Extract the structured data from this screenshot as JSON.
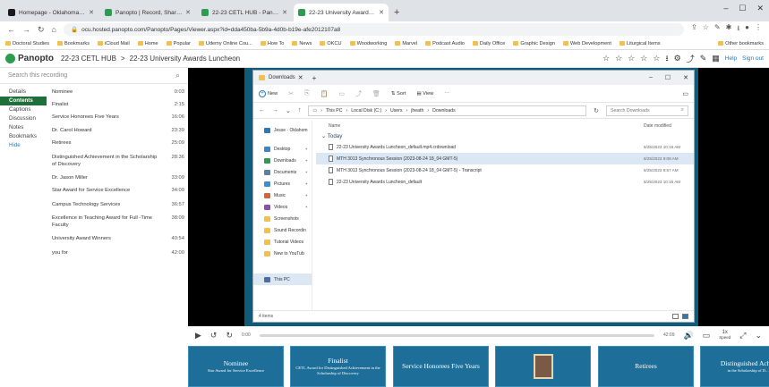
{
  "browser": {
    "tabs": [
      {
        "title": "Homepage - Oklahoma City Uni...",
        "fav": "#1a1a1a",
        "active": false
      },
      {
        "title": "Panopto | Record, Share, and M...",
        "fav": "#2e9c4f",
        "active": false
      },
      {
        "title": "22-23 CETL HUB - Panopto",
        "fav": "#2e9c4f",
        "active": false
      },
      {
        "title": "22-23 University Awards Lunche...",
        "fav": "#2e9c4f",
        "active": true
      }
    ],
    "url": "ocu.hosted.panopto.com/Panopto/Pages/Viewer.aspx?id=dda450ba-5b9a-4d0b-b19e-afe2012107a8",
    "bookmarks": [
      "Doctoral Studies",
      "Bookmarks",
      "iCloud Mail",
      "Home",
      "Popular",
      "Udemy Online Cou...",
      "How To",
      "News",
      "OKCU",
      "Woodworking",
      "Marvel",
      "Podcast Audio",
      "Daily Office",
      "Graphic Design",
      "Web Development",
      "Liturgical Items"
    ],
    "other_bookmarks": "Other bookmarks"
  },
  "panopto": {
    "logo": "Panopto",
    "breadcrumb_folder": "22-23 CETL HUB",
    "breadcrumb_sep": ">",
    "breadcrumb_title": "22-23 University Awards Luncheon",
    "help": "Help",
    "signout": "Sign out",
    "search_placeholder": "Search this recording",
    "nav": [
      "Details",
      "Contents",
      "Captions",
      "Discussion",
      "Notes",
      "Bookmarks",
      "Hide"
    ],
    "chapters": [
      {
        "title": "Nominee",
        "time": "0:03"
      },
      {
        "title": "Finalist",
        "time": "2:15"
      },
      {
        "title": "Service Honorees Five Years",
        "time": "16:06"
      },
      {
        "title": "Dr. Carol Howard",
        "time": "23:39"
      },
      {
        "title": "Retirees",
        "time": "25:09"
      },
      {
        "title": "Distinguished Achievement in the Scholarship of Discovery",
        "time": "28:36"
      },
      {
        "title": "Dr. Jason Miller",
        "time": "33:09"
      },
      {
        "title": "Star Award for Service Excellence",
        "time": "34:09"
      },
      {
        "title": "Campus Technology Services",
        "time": "36:57"
      },
      {
        "title": "Excellence in Teaching Award for Full -Time Faculty",
        "time": "38:09"
      },
      {
        "title": "University Award Winners",
        "time": "40:54"
      },
      {
        "title": "you for",
        "time": "42:00"
      }
    ]
  },
  "explorer": {
    "title": "Downloads",
    "new_label": "New",
    "sort_label": "Sort",
    "view_label": "View",
    "path": [
      "This PC",
      "Local Disk (C:)",
      "Users",
      "jheath",
      "Downloads"
    ],
    "search_placeholder": "Search Downloads",
    "col_name": "Name",
    "col_date": "Date modified",
    "group": "Today",
    "quick": [
      {
        "label": "Jesse - Oklahom",
        "color": "#2a7ab8"
      },
      {
        "label": "Desktop",
        "color": "#3d86c6"
      },
      {
        "label": "Downloads",
        "color": "#2e9c4f"
      },
      {
        "label": "Documents",
        "color": "#5c7fa3"
      },
      {
        "label": "Pictures",
        "color": "#3c8fd0"
      },
      {
        "label": "Music",
        "color": "#d2663d"
      },
      {
        "label": "Videos",
        "color": "#8a4fb8"
      },
      {
        "label": "Screenshots",
        "color": "#f3c14b"
      },
      {
        "label": "Sound Recordin",
        "color": "#f3c14b"
      },
      {
        "label": "Tutorial Videos",
        "color": "#f3c14b"
      },
      {
        "label": "New to YouTub",
        "color": "#f3c14b"
      },
      {
        "label": "This PC",
        "color": "#4a6fa0"
      }
    ],
    "files": [
      {
        "name": "22-23 University Awards Luncheon_default.mp4.crdownload",
        "date": "8/25/2023 10:16 AM"
      },
      {
        "name": "MTH 3013 Synchronous Session (2023-08-24 18_04 GMT-5)",
        "date": "8/25/2023 9:08 AM"
      },
      {
        "name": "MTH 3013 Synchronous Session (2023-08-24 18_04 GMT-5) - Transcript",
        "date": "8/25/2023 8:57 AM"
      },
      {
        "name": "22-23 University Awards Luncheon_default",
        "date": "8/25/2023 10:16 AM"
      }
    ],
    "status": "4 items"
  },
  "player": {
    "time_left": "0:00",
    "time_right": "42:09",
    "speed": "1x",
    "speed_label": "Speed",
    "progress": 0.0
  },
  "thumbnails": [
    {
      "big": "Nominee",
      "small": "Star Award for Service Excellence",
      "photo": false
    },
    {
      "big": "Finalist",
      "small": "CETL Award for Distinguished Achievement in the Scholarship of Discovery",
      "photo": false
    },
    {
      "big": "Service Honorees Five Years",
      "small": "",
      "photo": false
    },
    {
      "big": "",
      "small": "",
      "photo": true
    },
    {
      "big": "Retirees",
      "small": "",
      "photo": false
    },
    {
      "big": "Distinguished Ach...",
      "small": "in the Scholarship of D...",
      "photo": false
    }
  ]
}
